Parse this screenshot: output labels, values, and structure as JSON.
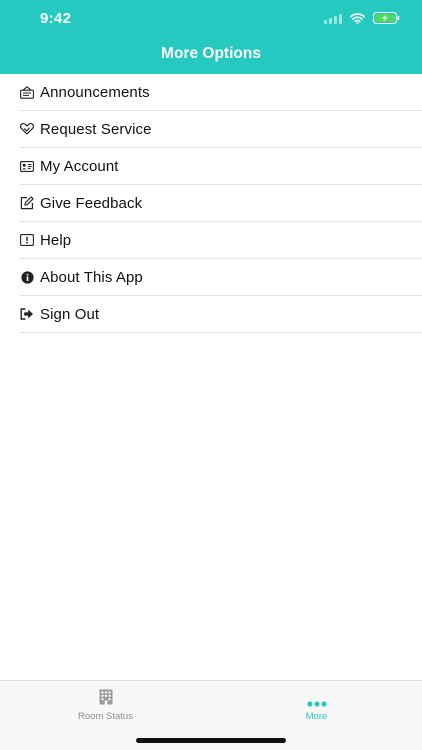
{
  "status_bar": {
    "time": "9:42",
    "icons": [
      "signal-icon",
      "wifi-icon",
      "battery-charging-icon"
    ]
  },
  "nav": {
    "title": "More Options"
  },
  "menu": {
    "items": [
      {
        "label": "Announcements",
        "icon": "announcement-icon"
      },
      {
        "label": "Request Service",
        "icon": "handshake-icon"
      },
      {
        "label": "My Account",
        "icon": "id-card-icon"
      },
      {
        "label": "Give Feedback",
        "icon": "edit-icon"
      },
      {
        "label": "Help",
        "icon": "help-icon"
      },
      {
        "label": "About This App",
        "icon": "info-icon"
      },
      {
        "label": "Sign Out",
        "icon": "sign-out-icon"
      }
    ]
  },
  "tab_bar": {
    "tabs": [
      {
        "label": "Room Status",
        "icon": "building-icon",
        "active": false
      },
      {
        "label": "More",
        "icon": "more-dots-icon",
        "active": true
      }
    ]
  },
  "colors": {
    "accent": "#26c9bf",
    "inactive": "#8e8e8e",
    "battery_fill": "#4cd964"
  }
}
